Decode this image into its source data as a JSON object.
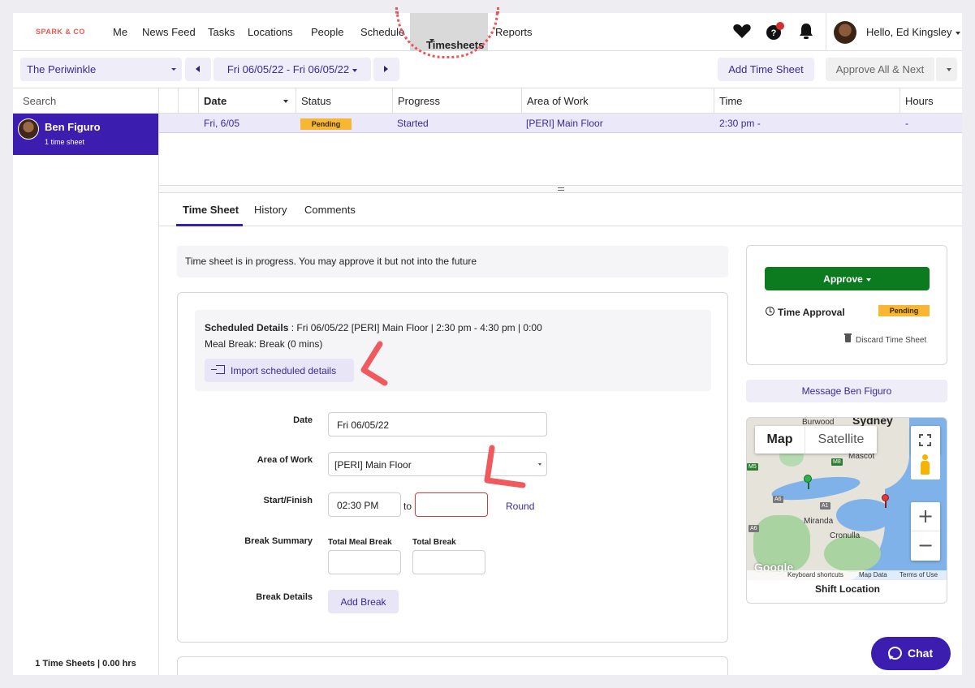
{
  "nav": {
    "logo": "SPARK & CO",
    "items": [
      "Me",
      "News Feed",
      "Tasks",
      "Locations",
      "People",
      "Schedule",
      "Timesheets",
      "Reports"
    ],
    "active": "Timesheets",
    "greeting": "Hello, Ed Kingsley"
  },
  "toolbar": {
    "location": "The Periwinkle",
    "date_range": "Fri 06/05/22 - Fri 06/05/22",
    "add_time_sheet": "Add Time Sheet",
    "approve_all_next": "Approve All & Next"
  },
  "sidebar": {
    "search_placeholder": "Search",
    "person": {
      "name": "Ben Figuro",
      "sub": "1 time sheet"
    },
    "footer": "1 Time Sheets | 0.00 hrs"
  },
  "grid": {
    "headers": [
      "Date",
      "Status",
      "Progress",
      "Area of Work",
      "Time",
      "Hours"
    ],
    "row": {
      "date": "Fri, 6/05",
      "status": "Pending",
      "progress": "Started",
      "area": "[PERI] Main Floor",
      "time": "2:30 pm -",
      "hours": "-"
    }
  },
  "tabs": [
    "Time Sheet",
    "History",
    "Comments"
  ],
  "banner": "Time sheet is in progress. You may approve it but not into the future",
  "scheduled": {
    "label": "Scheduled Details",
    "detail": " : Fri 06/05/22 [PERI] Main Floor | 2:30 pm - 4:30 pm | 0:00",
    "meal_break": "Meal Break: Break (0 mins)",
    "import_label": "Import scheduled details"
  },
  "form": {
    "date_label": "Date",
    "date_value": "Fri 06/05/22",
    "area_label": "Area of Work",
    "area_value": "[PERI] Main Floor",
    "start_finish_label": "Start/Finish",
    "start_value": "02:30 PM",
    "finish_value": "",
    "to_label": "to",
    "round_label": "Round",
    "break_summary_label": "Break Summary",
    "total_meal_break_label": "Total Meal Break",
    "total_break_label": "Total Break",
    "break_details_label": "Break Details",
    "add_break_label": "Add Break"
  },
  "approval": {
    "approve_label": "Approve",
    "time_approval_label": "Time Approval",
    "status": "Pending",
    "discard_label": "Discard Time Sheet",
    "message_label": "Message Ben Figuro"
  },
  "map": {
    "type_map": "Map",
    "type_satellite": "Satellite",
    "zoom_in": "+",
    "zoom_out": "−",
    "places": [
      "Burwood",
      "Sydney",
      "Mascot",
      "Miranda",
      "Cronulla"
    ],
    "roads": [
      "M5",
      "M8",
      "A6",
      "A1",
      "A6"
    ],
    "google": "Google",
    "keyboard_shortcuts": "Keyboard shortcuts",
    "map_data": "Map Data",
    "terms": "Terms of Use",
    "caption": "Shift Location"
  },
  "chat_label": "Chat",
  "colors": {
    "primary": "#3b1db0",
    "lavender": "#eeedf8",
    "approve_green": "#0c7a1e",
    "pending": "#f7b733",
    "error": "#d23b3b",
    "annotation": "#e8555b"
  }
}
